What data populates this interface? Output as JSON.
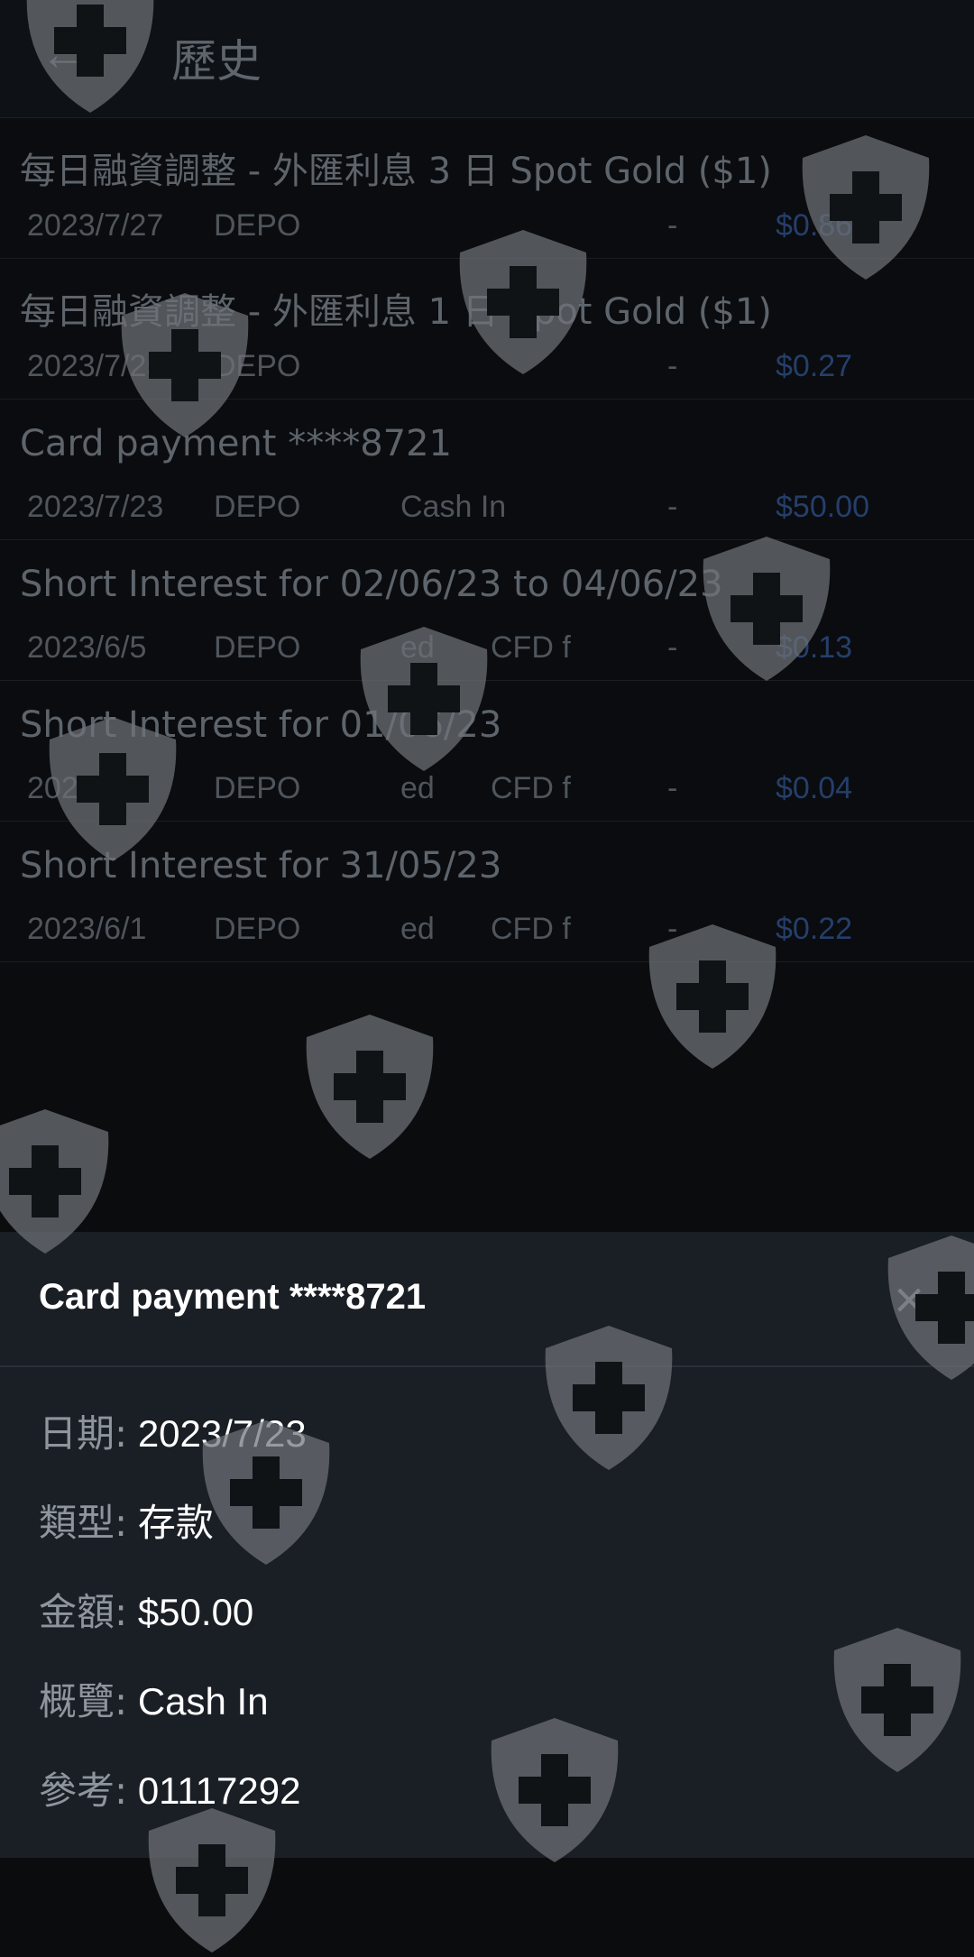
{
  "header": {
    "back_icon": "arrow-left-icon",
    "title": "歷史"
  },
  "history": [
    {
      "title": "每日融資調整 - 外匯利息 3 日 Spot Gold ($1)",
      "date": "2023/7/27",
      "type": "DEPO",
      "summary": "",
      "extra": "",
      "dash": "-",
      "amount": "$0.86"
    },
    {
      "title": "每日融資調整 - 外匯利息 1 日 Spot Gold ($1)",
      "date": "2023/7/25",
      "type": "DEPO",
      "summary": "",
      "extra": "",
      "dash": "-",
      "amount": "$0.27"
    },
    {
      "title": "Card payment ****8721",
      "date": "2023/7/23",
      "type": "DEPO",
      "summary": "Cash In",
      "extra": "",
      "dash": "-",
      "amount": "$50.00"
    },
    {
      "title": "Short Interest for 02/06/23 to 04/06/23",
      "date": "2023/6/5",
      "type": "DEPO",
      "summary": "ed",
      "extra": "CFD f",
      "dash": "-",
      "amount": "$0.13"
    },
    {
      "title": "Short Interest for 01/06/23",
      "date": "2023/6/2",
      "type": "DEPO",
      "summary": "ed",
      "extra": "CFD f",
      "dash": "-",
      "amount": "$0.04"
    },
    {
      "title": "Short Interest for 31/05/23",
      "date": "2023/6/1",
      "type": "DEPO",
      "summary": "ed",
      "extra": "CFD f",
      "dash": "-",
      "amount": "$0.22"
    }
  ],
  "detail": {
    "title": "Card payment ****8721",
    "close_icon": "close-icon",
    "fields": [
      {
        "label": "日期:",
        "value": "2023/7/23"
      },
      {
        "label": "類型:",
        "value": "存款"
      },
      {
        "label": "金額:",
        "value": "$50.00"
      },
      {
        "label": "概覽:",
        "value": "Cash In"
      },
      {
        "label": "參考:",
        "value": "01117292"
      }
    ]
  },
  "colors": {
    "accent_blue": "#253f6b",
    "sheet_bg": "#1a1f25",
    "watermark": "#6f7378"
  }
}
